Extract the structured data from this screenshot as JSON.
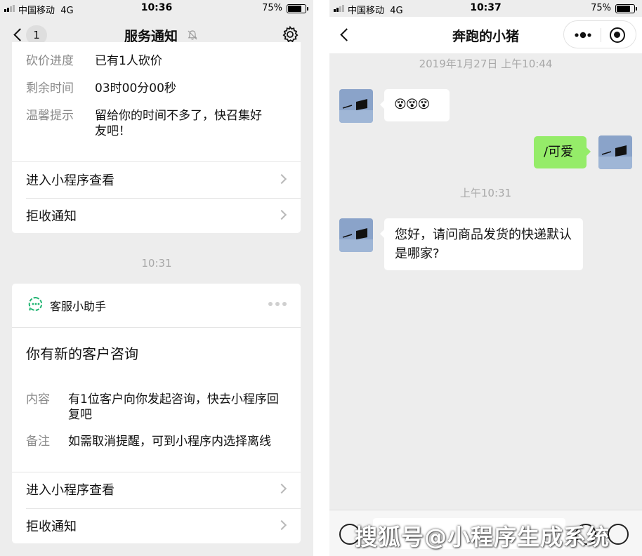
{
  "left": {
    "status": {
      "carrier": "中国移动",
      "network": "4G",
      "time": "10:36",
      "battery": "75%",
      "battery_level": 0.75
    },
    "nav": {
      "unread_count": "1",
      "title": "服务通知"
    },
    "card1": {
      "rows": [
        {
          "label": "砍价进度",
          "value": "已有1人砍价"
        },
        {
          "label": "剩余时间",
          "value": "03时00分00秒"
        },
        {
          "label": "温馨提示",
          "value": "留给你的时间不多了，快召集好友吧！"
        }
      ],
      "actions": [
        "进入小程序查看",
        "拒收通知"
      ]
    },
    "timestamp": "10:31",
    "card2": {
      "source": "客服小助手",
      "title": "你有新的客户咨询",
      "rows": [
        {
          "label": "内容",
          "value": "有1位客户向你发起咨询，快去小程序回复吧"
        },
        {
          "label": "备注",
          "value": "如需取消提醒，可到小程序内选择离线"
        }
      ],
      "actions": [
        "进入小程序查看",
        "拒收通知"
      ]
    }
  },
  "right": {
    "status": {
      "carrier": "中国移动",
      "network": "4G",
      "time": "10:37",
      "battery": "75%",
      "battery_level": 0.75
    },
    "nav": {
      "title": "奔跑的小猪"
    },
    "messages": [
      {
        "type": "time",
        "text": "2019年1月27日 上午10:44"
      },
      {
        "type": "in",
        "text": "😵😵😵"
      },
      {
        "type": "out",
        "text": "/可爱"
      },
      {
        "type": "time",
        "text": "上午10:31"
      },
      {
        "type": "in",
        "text": "您好，请问商品发货的快递默认是哪家?"
      }
    ]
  },
  "watermark": "搜狐号@小程序生成系统",
  "colors": {
    "page_bg": "#ededed",
    "outgoing_bubble": "#95ec69",
    "label_gray": "#8a8a8a",
    "timestamp_gray": "#a8a8a8"
  }
}
